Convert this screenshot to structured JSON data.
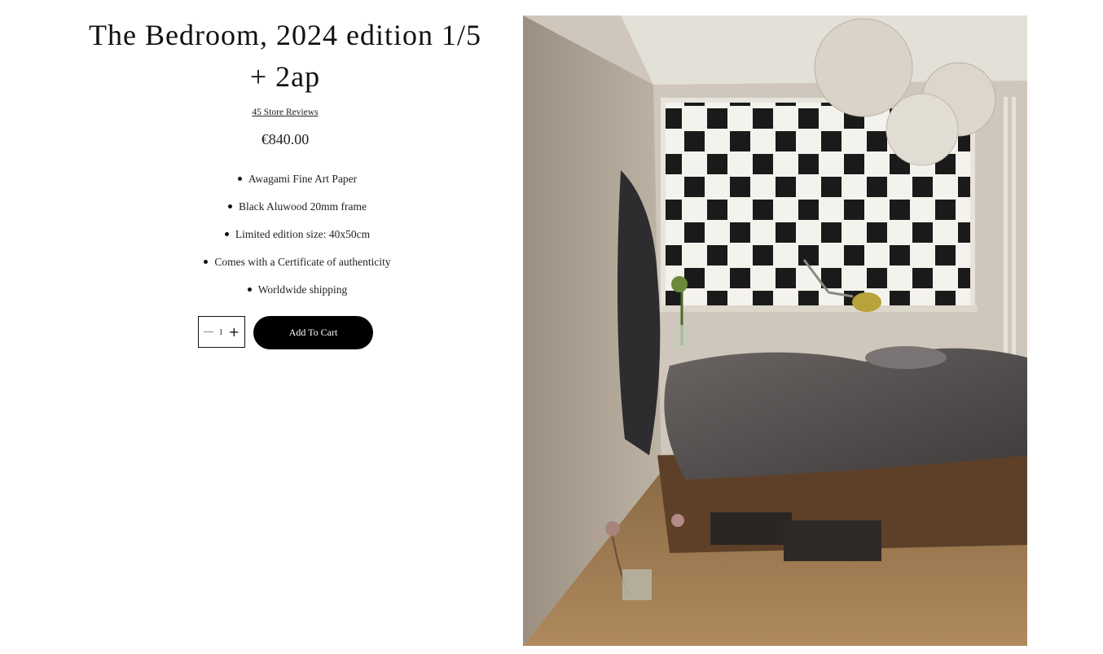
{
  "product": {
    "title": "The Bedroom, 2024 edition 1/5 + 2ap",
    "reviews_link": "45 Store Reviews",
    "price": "€840.00",
    "features": [
      "Awagami Fine Art Paper",
      "Black Aluwood 20mm frame",
      "Limited edition size: 40x50cm",
      "Comes with a Certificate of authenticity",
      "Worldwide shipping"
    ],
    "quantity": "1",
    "add_to_cart_label": "Add To Cart"
  },
  "icons": {
    "decrease": "minus-icon",
    "increase": "plus-icon",
    "bullet": "bullet-dot-icon"
  },
  "colors": {
    "button_bg": "#000000",
    "button_text": "#ffffff",
    "text": "#111111"
  }
}
